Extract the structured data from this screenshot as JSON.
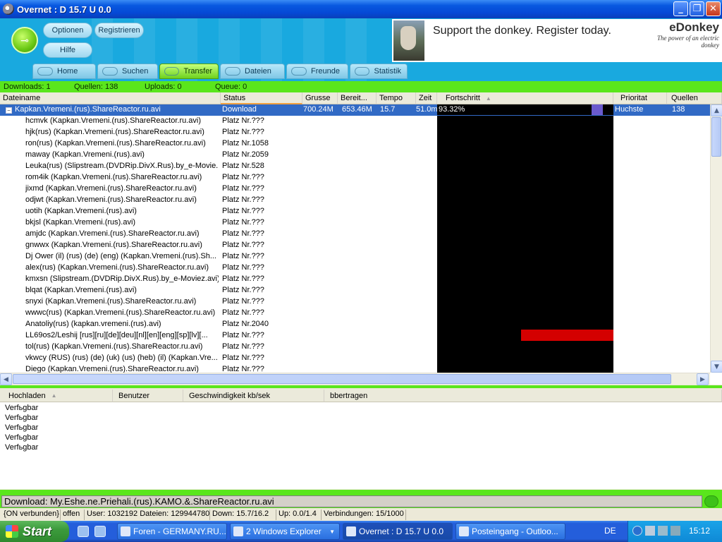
{
  "window": {
    "title": "Overnet : D 15.7 U 0.0",
    "min": "_",
    "max": "❐",
    "close": "✕"
  },
  "header": {
    "buttons": {
      "optionen": "Optionen",
      "registrieren": "Registrieren",
      "hilfe": "Hilfe"
    },
    "banner": {
      "slogan": "Support the donkey. Register today.",
      "brand": "eDonkey",
      "tagline": "The power of an electric donkey"
    },
    "tabs": [
      "Home",
      "Suchen",
      "Transfer",
      "Dateien",
      "Freunde",
      "Statistik"
    ],
    "active_tab": "Transfer"
  },
  "stats": {
    "downloads": "Downloads: 1",
    "quellen": "Quellen: 138",
    "uploads": "Uploads: 0",
    "queue": "Queue: 0"
  },
  "download_columns": [
    "Dateiname",
    "Status",
    "Grusse",
    "Bereit...",
    "Tempo",
    "Zeit",
    "Fortschritt",
    "Prioritat",
    "Quellen"
  ],
  "download_main": {
    "name": "Kapkan.Vremeni.(rus).ShareReactor.ru.avi",
    "status": "Download",
    "size": "700.24M",
    "ready": "653.46M",
    "speed": "15.7",
    "time": "51.0m",
    "progress_text": "93.32%",
    "progress": 0.9332,
    "priority": "Huchste",
    "sources": "138"
  },
  "sources": [
    {
      "name": "hcmvk (Kapkan.Vremeni.(rus).ShareReactor.ru.avi)",
      "status": "Platz Nr.???"
    },
    {
      "name": "hjk(rus) (Kapkan.Vremeni.(rus).ShareReactor.ru.avi)",
      "status": "Platz Nr.???"
    },
    {
      "name": "ron(rus) (Kapkan.Vremeni.(rus).ShareReactor.ru.avi)",
      "status": "Platz Nr.1058"
    },
    {
      "name": "maway (Kapkan.Vremeni.(rus).avi)",
      "status": "Platz Nr.2059"
    },
    {
      "name": "Leuka(rus) (Slipstream.(DVDRip.DivX.Rus).by_e-Movie...",
      "status": "Platz Nr.528"
    },
    {
      "name": "rom4ik (Kapkan.Vremeni.(rus).ShareReactor.ru.avi)",
      "status": "Platz Nr.???"
    },
    {
      "name": "jixmd (Kapkan.Vremeni.(rus).ShareReactor.ru.avi)",
      "status": "Platz Nr.???"
    },
    {
      "name": "odjwt (Kapkan.Vremeni.(rus).ShareReactor.ru.avi)",
      "status": "Platz Nr.???"
    },
    {
      "name": "uotih (Kapkan.Vremeni.(rus).avi)",
      "status": "Platz Nr.???"
    },
    {
      "name": "bkjsl (Kapkan.Vremeni.(rus).avi)",
      "status": "Platz Nr.???"
    },
    {
      "name": "amjdc (Kapkan.Vremeni.(rus).ShareReactor.ru.avi)",
      "status": "Platz Nr.???"
    },
    {
      "name": "gnwwx (Kapkan.Vremeni.(rus).ShareReactor.ru.avi)",
      "status": "Platz Nr.???"
    },
    {
      "name": "Dj Ower (il) (rus) (de) (eng) (Kapkan.Vremeni.(rus).Sh...",
      "status": "Platz Nr.???"
    },
    {
      "name": "alex(rus) (Kapkan.Vremeni.(rus).ShareReactor.ru.avi)",
      "status": "Platz Nr.???"
    },
    {
      "name": "kmxsn (Slipstream.(DVDRip.DivX.Rus).by_e-Moviez.avi)",
      "status": "Platz Nr.???"
    },
    {
      "name": "blqat (Kapkan.Vremeni.(rus).avi)",
      "status": "Platz Nr.???"
    },
    {
      "name": "snyxi (Kapkan.Vremeni.(rus).ShareReactor.ru.avi)",
      "status": "Platz Nr.???"
    },
    {
      "name": "wwwc(rus) (Kapkan.Vremeni.(rus).ShareReactor.ru.avi)",
      "status": "Platz Nr.???"
    },
    {
      "name": "Anatoliy(rus) (kapkan.vremeni.(rus).avi)",
      "status": "Platz Nr.2040"
    },
    {
      "name": "LL69os2/Leshij [rus][ru][de][deu][nl][en][eng][sp][lv][...",
      "status": "Platz Nr.???"
    },
    {
      "name": "tol(rus) (Kapkan.Vremeni.(rus).ShareReactor.ru.avi)",
      "status": "Platz Nr.???"
    },
    {
      "name": "vkwcy (RUS) (rus) (de) (uk) (us) (heb) (il) (Kapkan.Vre...",
      "status": "Platz Nr.???"
    },
    {
      "name": "Diego (Kapkan.Vremeni.(rus).ShareReactor.ru.avi)",
      "status": "Platz Nr.???"
    }
  ],
  "upload_columns": [
    "Hochladen",
    "Benutzer",
    "Geschwindigkeit kb/sek",
    "bbertragen"
  ],
  "upload_rows": [
    "Verfьgbar",
    "Verfьgbar",
    "Verfьgbar",
    "Verfьgbar",
    "Verfьgbar"
  ],
  "download_status": "Download: My.Eshe.ne.Priehali.(rus).KAMO.&.ShareReactor.ru.avi",
  "statusbar": {
    "connection": "{ON verbunden}",
    "mode": "offen",
    "users": "User: 1032192 Dateien: 129944780",
    "down": "Down: 15.7/16.2",
    "up": "Up: 0.0/1.4",
    "connections": "Verbindungen: 15/1000"
  },
  "taskbar": {
    "start": "Start",
    "tasks": [
      "Foren - GERMANY.RU...",
      "2 Windows Explorer",
      "Overnet : D 15.7 U 0.0",
      "Posteingang - Outloo..."
    ],
    "lang": "DE",
    "clock": "15:12"
  },
  "colors": {
    "accent_green": "#5ae61c",
    "header_blue": "#19a9df",
    "selection": "#316ac5",
    "progress_fill": "#6a5acd"
  }
}
